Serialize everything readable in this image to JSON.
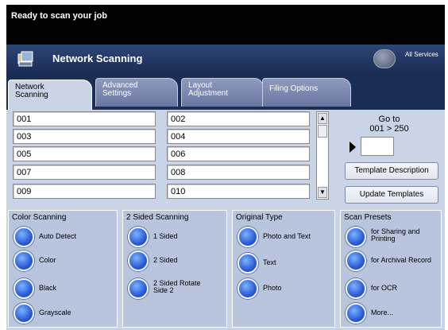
{
  "status": {
    "message": "Ready to scan your job"
  },
  "header": {
    "title": "Network Scanning",
    "all_services": "All Services"
  },
  "tabs": [
    {
      "line1": "Network",
      "line2": "Scanning"
    },
    {
      "line1": "Advanced",
      "line2": "Settings"
    },
    {
      "line1": "Layout",
      "line2": "Adjustment"
    },
    {
      "line1": "Filing Options",
      "line2": ""
    }
  ],
  "templates": [
    "001",
    "002",
    "003",
    "004",
    "005",
    "006",
    "007",
    "008",
    "009",
    "010"
  ],
  "goto": {
    "line1": "Go to",
    "line2": "001 > 250",
    "value": ""
  },
  "buttons": {
    "template_description": "Template Description",
    "update_templates": "Update Templates"
  },
  "groups": {
    "color_scanning": {
      "title": "Color Scanning",
      "options": [
        "Auto Detect",
        "Color",
        "Black",
        "Grayscale"
      ]
    },
    "two_sided": {
      "title": "2 Sided Scanning",
      "options": [
        [
          "1 Sided"
        ],
        [
          "2 Sided"
        ],
        [
          "2 Sided Rotate",
          "Side 2"
        ]
      ]
    },
    "original_type": {
      "title": "Original Type",
      "options": [
        "Photo and Text",
        "Text",
        "Photo"
      ]
    },
    "scan_presets": {
      "title": "Scan Presets",
      "options": [
        [
          "for Sharing and",
          "Printing"
        ],
        [
          "for Archival Record"
        ],
        [
          "for OCR"
        ],
        [
          "More..."
        ]
      ]
    }
  }
}
